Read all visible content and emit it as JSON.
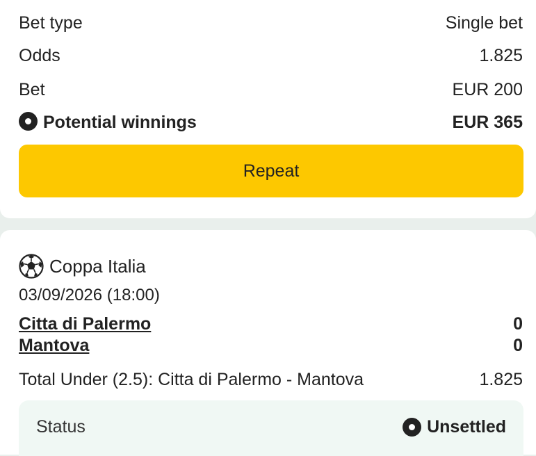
{
  "summary": {
    "bet_type_label": "Bet type",
    "bet_type_value": "Single bet",
    "odds_label": "Odds",
    "odds_value": "1.825",
    "bet_label": "Bet",
    "bet_value": "EUR 200",
    "winnings_label": "Potential winnings",
    "winnings_value": "EUR 365",
    "repeat_label": "Repeat"
  },
  "event": {
    "league": "Coppa Italia",
    "datetime": "03/09/2026 (18:00)",
    "home_team": "Citta di Palermo",
    "home_score": "0",
    "away_team": "Mantova",
    "away_score": "0",
    "market": "Total Under (2.5): Citta di Palermo - Mantova",
    "market_odds": "1.825",
    "status_label": "Status",
    "status_value": "Unsettled"
  },
  "colors": {
    "accent": "#fdc800",
    "background": "#e9efec",
    "status_box": "#f0f8f4"
  },
  "icons": {
    "winnings": "circle-dot-icon",
    "league": "soccer-ball-icon",
    "status": "circle-dot-icon"
  }
}
